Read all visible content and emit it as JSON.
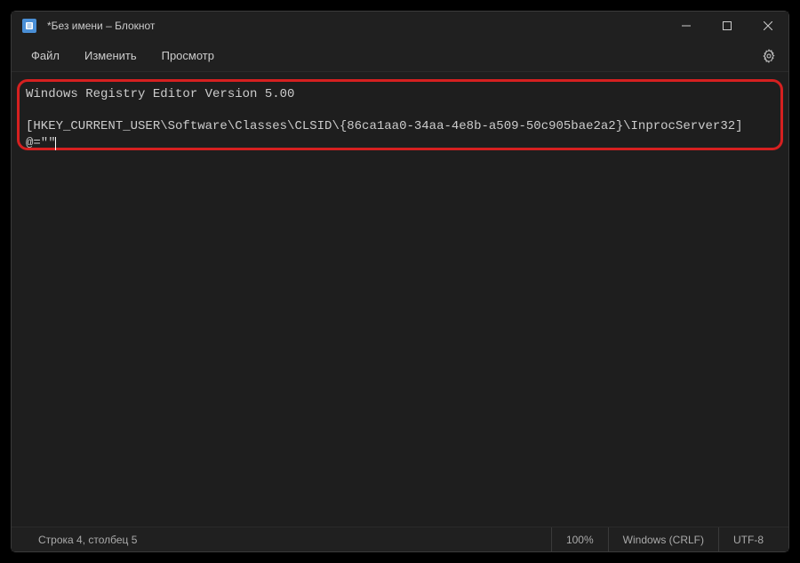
{
  "titlebar": {
    "title": "*Без имени – Блокнот"
  },
  "menubar": {
    "file": "Файл",
    "edit": "Изменить",
    "view": "Просмотр"
  },
  "editor": {
    "line1": "Windows Registry Editor Version 5.00",
    "line2": "",
    "line3": "[HKEY_CURRENT_USER\\Software\\Classes\\CLSID\\{86ca1aa0-34aa-4e8b-a509-50c905bae2a2}\\InprocServer32]",
    "line4": "@=\"\""
  },
  "statusbar": {
    "position": "Строка 4, столбец 5",
    "zoom": "100%",
    "line_ending": "Windows (CRLF)",
    "encoding": "UTF-8"
  }
}
